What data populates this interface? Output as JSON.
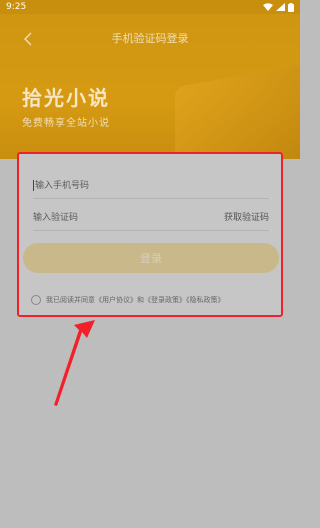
{
  "status_bar": {
    "time": "9:25"
  },
  "header": {
    "title": "手机验证码登录",
    "brand_title": "拾光小说",
    "brand_subtitle": "免费畅享全站小说"
  },
  "form": {
    "phone_placeholder": "输入手机号码",
    "code_placeholder": "输入验证码",
    "get_code_label": "获取验证码",
    "login_label": "登录",
    "agreement_text": "我已阅读并同意《用户协议》和《登录政策》《隐私政策》"
  },
  "colors": {
    "header_accent": "#d69a12",
    "highlight_border": "#f0212b",
    "annotation_arrow": "#f0212b"
  },
  "icons": {
    "back": "back-arrow-icon",
    "wifi": "wifi-icon",
    "signal": "signal-icon",
    "battery": "battery-icon"
  }
}
